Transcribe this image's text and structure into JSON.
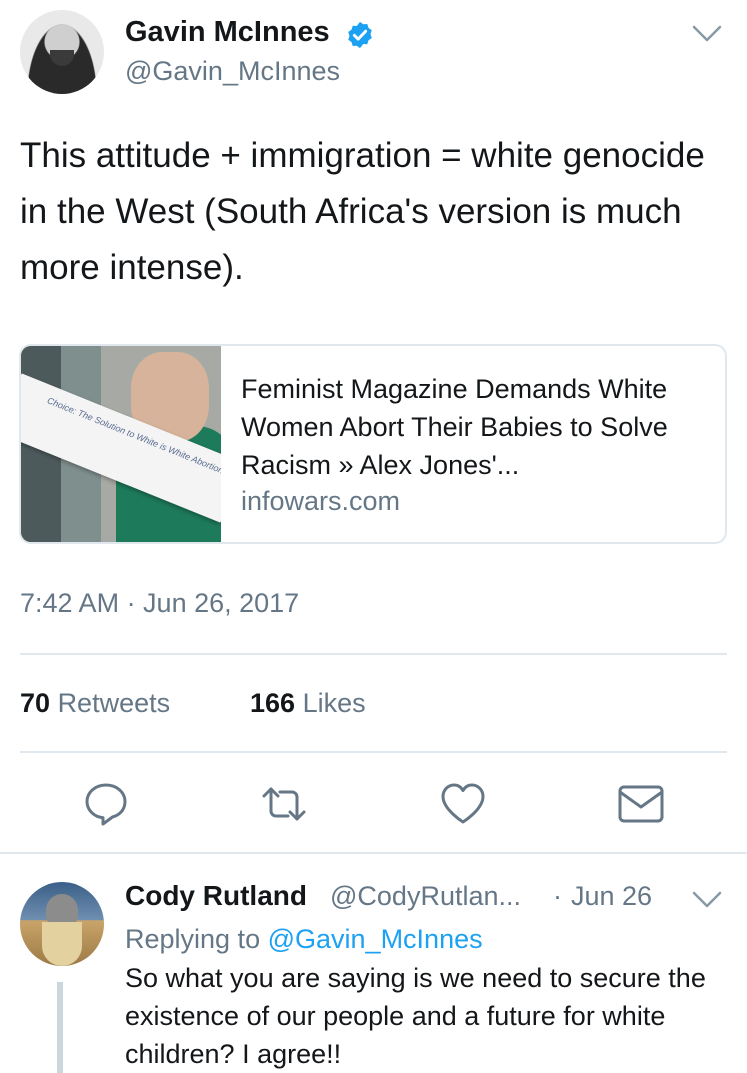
{
  "tweet": {
    "author_name": "Gavin McInnes",
    "author_handle": "@Gavin_McInnes",
    "text": "This attitude + immigration = white genocide in the West (South Africa's version is much more intense).",
    "card": {
      "title": "Feminist Magazine Demands White Women Abort Their Babies to Solve Racism » Alex Jones'...",
      "domain": "infowars.com",
      "image_text": "Choice: The Solution to White is White Abortion"
    },
    "timestamp": "7:42 AM · Jun 26, 2017",
    "retweets_count": "70",
    "retweets_label": "Retweets",
    "likes_count": "166",
    "likes_label": "Likes"
  },
  "actions": {
    "reply_icon": "reply-icon",
    "retweet_icon": "retweet-icon",
    "like_icon": "heart-icon",
    "dm_icon": "envelope-icon"
  },
  "reply": {
    "author_name": "Cody Rutland",
    "author_handle": "@CodyRutlan...",
    "separator": "·",
    "date": "Jun 26",
    "replying_prefix": "Replying to",
    "replying_to": "@Gavin_McInnes",
    "text": "So what you are saying is we need to secure the existence of our people and a future for white children? I agree!!"
  },
  "colors": {
    "primary_text": "#14171a",
    "secondary_text": "#657786",
    "link_blue": "#1da1f2",
    "divider": "#e1e8ed",
    "icon": "#657786"
  }
}
